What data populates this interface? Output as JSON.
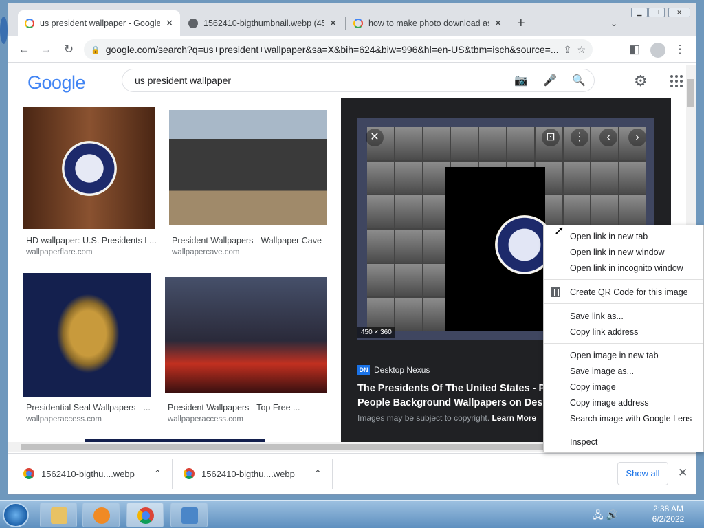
{
  "tabs": [
    {
      "title": "us president wallpaper - Google",
      "icon": "google-icon",
      "active": true
    },
    {
      "title": "1562410-bigthumbnail.webp (45(",
      "icon": "globe-icon",
      "active": false
    },
    {
      "title": "how to make photo download as",
      "icon": "google-icon",
      "active": false
    }
  ],
  "address": {
    "url": "google.com/search?q=us+president+wallpaper&sa=X&bih=624&biw=996&hl=en-US&tbm=isch&source=..."
  },
  "google": {
    "logo": "Google",
    "query": "us president wallpaper"
  },
  "results": [
    {
      "title": "HD wallpaper: U.S. Presidents L...",
      "source": "wallpaperflare.com"
    },
    {
      "title": "President Wallpapers - Wallpaper Cave",
      "source": "wallpapercave.com"
    },
    {
      "title": "Presidential Seal Wallpapers - ...",
      "source": "wallpaperaccess.com"
    },
    {
      "title": "President Wallpapers - Top Free ...",
      "source": "wallpaperaccess.com"
    }
  ],
  "preview": {
    "dimensions": "450 × 360",
    "site_badge": "DN",
    "site": "Desktop Nexus",
    "title": "The Presidents Of The United States - Po People Background Wallpapers on Deskt",
    "copyright": "Images may be subject to copyright.",
    "learn_more": "Learn More"
  },
  "context_menu": {
    "group1": [
      "Open link in new tab",
      "Open link in new window",
      "Open link in incognito window"
    ],
    "qr": "Create QR Code for this image",
    "group2": [
      "Save link as...",
      "Copy link address"
    ],
    "group3": [
      "Open image in new tab",
      "Save image as...",
      "Copy image",
      "Copy image address",
      "Search image with Google Lens"
    ],
    "inspect": "Inspect"
  },
  "downloads": {
    "items": [
      "1562410-bigthu....webp",
      "1562410-bigthu....webp"
    ],
    "show_all": "Show all"
  },
  "taskbar": {
    "time": "2:38 AM",
    "date": "6/2/2022"
  },
  "colors": {
    "google_blue": "#4285f4",
    "google_red": "#ea4335",
    "google_yellow": "#fbbc05",
    "google_green": "#34a853",
    "link_blue": "#1a73e8"
  }
}
